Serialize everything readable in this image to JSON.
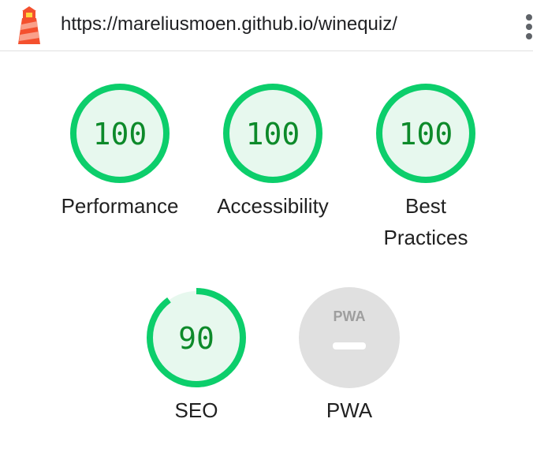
{
  "url": "https://mareliusmoen.github.io/winequiz/",
  "colors": {
    "pass": "#0cce6b",
    "pass_bg": "#e7f8ee",
    "pass_text": "#0d8a2a",
    "na": "#e0e0e0"
  },
  "gauges": [
    {
      "label": "Performance",
      "score": 100
    },
    {
      "label": "Accessibility",
      "score": 100
    },
    {
      "label": "Best Practices",
      "label_line1": "Best",
      "label_line2": "Practices",
      "score": 100
    },
    {
      "label": "SEO",
      "score": 90
    },
    {
      "label": "PWA",
      "badge": "PWA",
      "icon": "pwa-badge-icon"
    }
  ]
}
